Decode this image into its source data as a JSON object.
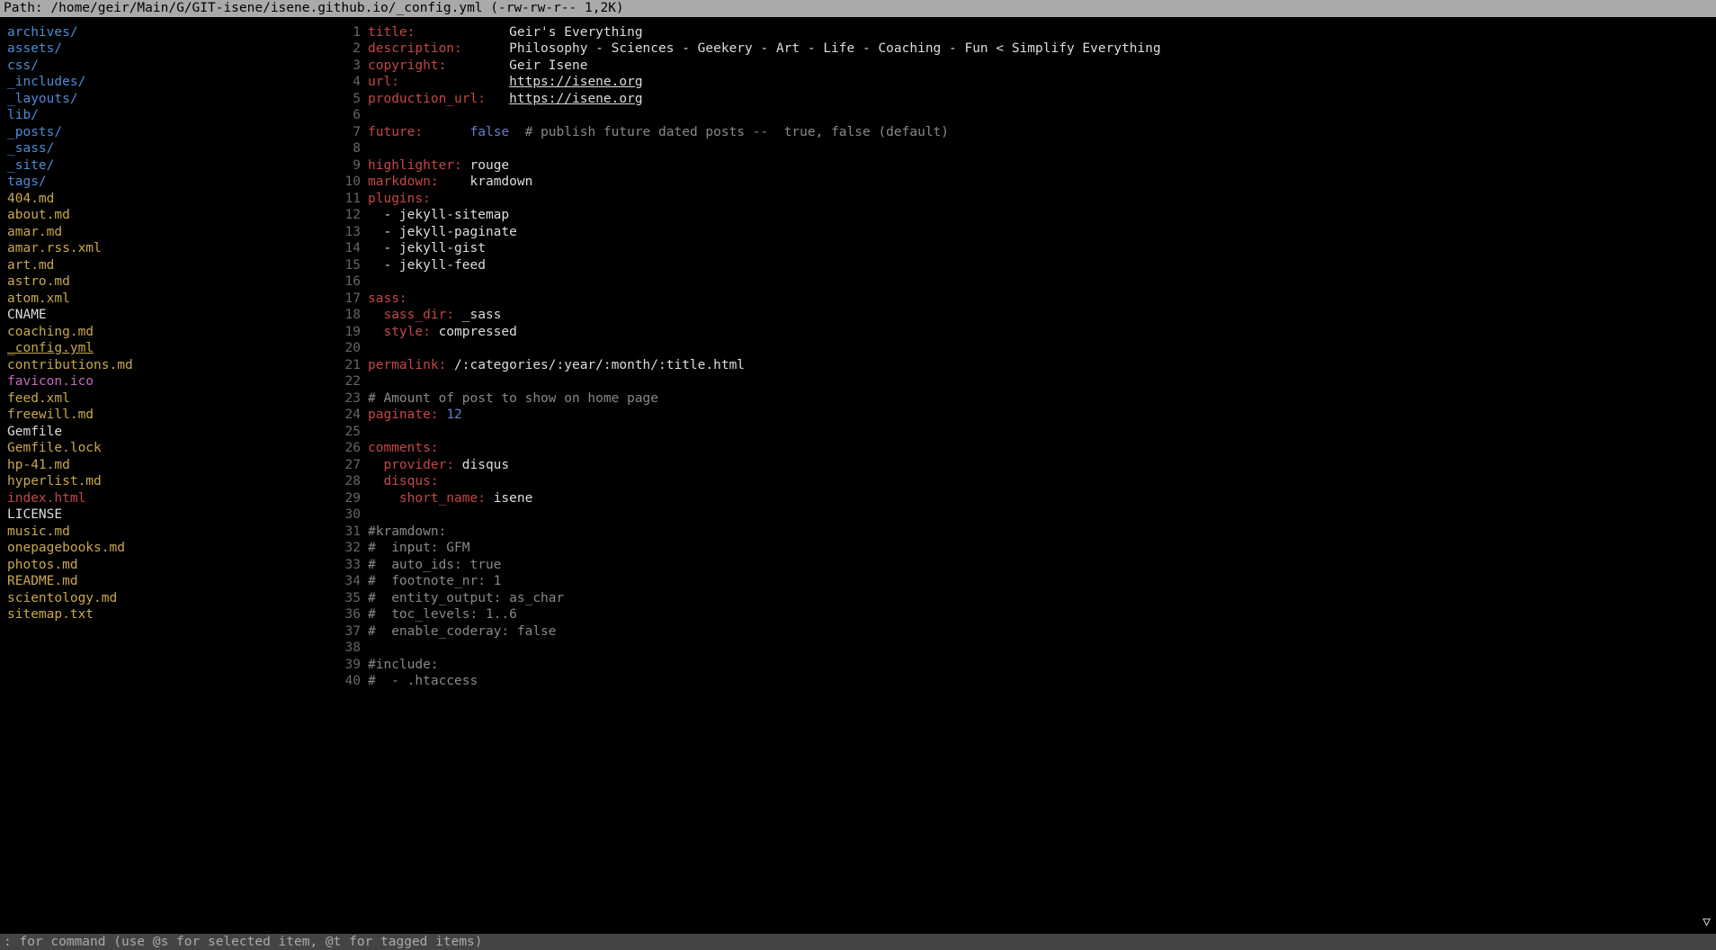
{
  "topbar": {
    "label": "Path: ",
    "path": "/home/geir/Main/G/GIT-isene/isene.github.io/_config.yml",
    "perms": " (-rw-rw-r-- 1,2K)"
  },
  "files": [
    {
      "name": "archives/",
      "cls": "c-dir"
    },
    {
      "name": "assets/",
      "cls": "c-dir"
    },
    {
      "name": "css/",
      "cls": "c-dir"
    },
    {
      "name": "_includes/",
      "cls": "c-dir"
    },
    {
      "name": "_layouts/",
      "cls": "c-dir"
    },
    {
      "name": "lib/",
      "cls": "c-dir"
    },
    {
      "name": "_posts/",
      "cls": "c-dir"
    },
    {
      "name": "_sass/",
      "cls": "c-dir"
    },
    {
      "name": "_site/",
      "cls": "c-dir"
    },
    {
      "name": "tags/",
      "cls": "c-dir"
    },
    {
      "name": "404.md",
      "cls": "c-yellow"
    },
    {
      "name": "about.md",
      "cls": "c-yellow"
    },
    {
      "name": "amar.md",
      "cls": "c-yellow"
    },
    {
      "name": "amar.rss.xml",
      "cls": "c-yellow"
    },
    {
      "name": "art.md",
      "cls": "c-yellow"
    },
    {
      "name": "astro.md",
      "cls": "c-yellow"
    },
    {
      "name": "atom.xml",
      "cls": "c-yellow"
    },
    {
      "name": "CNAME",
      "cls": "c-white"
    },
    {
      "name": "coaching.md",
      "cls": "c-yellow"
    },
    {
      "name": "_config.yml",
      "cls": "c-yellow",
      "selected": true
    },
    {
      "name": "contributions.md",
      "cls": "c-yellow"
    },
    {
      "name": "favicon.ico",
      "cls": "c-magenta"
    },
    {
      "name": "feed.xml",
      "cls": "c-yellow"
    },
    {
      "name": "freewill.md",
      "cls": "c-yellow"
    },
    {
      "name": "Gemfile",
      "cls": "c-white"
    },
    {
      "name": "Gemfile.lock",
      "cls": "c-yellow"
    },
    {
      "name": "hp-41.md",
      "cls": "c-yellow"
    },
    {
      "name": "hyperlist.md",
      "cls": "c-yellow"
    },
    {
      "name": "index.html",
      "cls": "c-red"
    },
    {
      "name": "LICENSE",
      "cls": "c-white"
    },
    {
      "name": "music.md",
      "cls": "c-yellow"
    },
    {
      "name": "onepagebooks.md",
      "cls": "c-yellow"
    },
    {
      "name": "photos.md",
      "cls": "c-yellow"
    },
    {
      "name": "README.md",
      "cls": "c-yellow"
    },
    {
      "name": "scientology.md",
      "cls": "c-yellow"
    },
    {
      "name": "sitemap.txt",
      "cls": "c-yellow"
    }
  ],
  "editor": [
    {
      "n": 1,
      "seg": [
        {
          "t": "title:            ",
          "c": "c-key"
        },
        {
          "t": "Geir's Everything",
          "c": "c-val"
        }
      ]
    },
    {
      "n": 2,
      "seg": [
        {
          "t": "description:      ",
          "c": "c-key"
        },
        {
          "t": "Philosophy - Sciences - Geekery - Art - Life - Coaching - Fun < Simplify Everything",
          "c": "c-val"
        }
      ]
    },
    {
      "n": 3,
      "seg": [
        {
          "t": "copyright:        ",
          "c": "c-key"
        },
        {
          "t": "Geir Isene",
          "c": "c-val"
        }
      ]
    },
    {
      "n": 4,
      "seg": [
        {
          "t": "url:              ",
          "c": "c-key"
        },
        {
          "t": "https://isene.org",
          "c": "c-link"
        }
      ]
    },
    {
      "n": 5,
      "seg": [
        {
          "t": "production_url:   ",
          "c": "c-key"
        },
        {
          "t": "https://isene.org",
          "c": "c-link"
        }
      ]
    },
    {
      "n": 6,
      "seg": []
    },
    {
      "n": 7,
      "seg": [
        {
          "t": "future:      ",
          "c": "c-key"
        },
        {
          "t": "false",
          "c": "c-blue"
        },
        {
          "t": "  # publish future dated posts --  true, false (default)",
          "c": "c-grey"
        }
      ]
    },
    {
      "n": 8,
      "seg": []
    },
    {
      "n": 9,
      "seg": [
        {
          "t": "highlighter: ",
          "c": "c-key"
        },
        {
          "t": "rouge",
          "c": "c-val"
        }
      ]
    },
    {
      "n": 10,
      "seg": [
        {
          "t": "markdown:    ",
          "c": "c-key"
        },
        {
          "t": "kramdown",
          "c": "c-val"
        }
      ]
    },
    {
      "n": 11,
      "seg": [
        {
          "t": "plugins:",
          "c": "c-key"
        }
      ]
    },
    {
      "n": 12,
      "seg": [
        {
          "t": "  - jekyll-sitemap",
          "c": "c-val"
        }
      ]
    },
    {
      "n": 13,
      "seg": [
        {
          "t": "  - jekyll-paginate",
          "c": "c-val"
        }
      ]
    },
    {
      "n": 14,
      "seg": [
        {
          "t": "  - jekyll-gist",
          "c": "c-val"
        }
      ]
    },
    {
      "n": 15,
      "seg": [
        {
          "t": "  - jekyll-feed",
          "c": "c-val"
        }
      ]
    },
    {
      "n": 16,
      "seg": []
    },
    {
      "n": 17,
      "seg": [
        {
          "t": "sass:",
          "c": "c-key"
        }
      ]
    },
    {
      "n": 18,
      "seg": [
        {
          "t": "  sass_dir: ",
          "c": "c-key"
        },
        {
          "t": "_sass",
          "c": "c-val"
        }
      ]
    },
    {
      "n": 19,
      "seg": [
        {
          "t": "  style: ",
          "c": "c-key"
        },
        {
          "t": "compressed",
          "c": "c-val"
        }
      ]
    },
    {
      "n": 20,
      "seg": []
    },
    {
      "n": 21,
      "seg": [
        {
          "t": "permalink: ",
          "c": "c-key"
        },
        {
          "t": "/:categories/:year/:month/:title.html",
          "c": "c-val"
        }
      ]
    },
    {
      "n": 22,
      "seg": []
    },
    {
      "n": 23,
      "seg": [
        {
          "t": "# Amount of post to show on home page",
          "c": "c-grey"
        }
      ]
    },
    {
      "n": 24,
      "seg": [
        {
          "t": "paginate: ",
          "c": "c-key"
        },
        {
          "t": "12",
          "c": "c-blue"
        }
      ]
    },
    {
      "n": 25,
      "seg": []
    },
    {
      "n": 26,
      "seg": [
        {
          "t": "comments:",
          "c": "c-key"
        }
      ]
    },
    {
      "n": 27,
      "seg": [
        {
          "t": "  provider: ",
          "c": "c-key"
        },
        {
          "t": "disqus",
          "c": "c-val"
        }
      ]
    },
    {
      "n": 28,
      "seg": [
        {
          "t": "  disqus:",
          "c": "c-key"
        }
      ]
    },
    {
      "n": 29,
      "seg": [
        {
          "t": "    short_name: ",
          "c": "c-key"
        },
        {
          "t": "isene",
          "c": "c-val"
        }
      ]
    },
    {
      "n": 30,
      "seg": []
    },
    {
      "n": 31,
      "seg": [
        {
          "t": "#kramdown:",
          "c": "c-grey"
        }
      ]
    },
    {
      "n": 32,
      "seg": [
        {
          "t": "#  input: GFM",
          "c": "c-grey"
        }
      ]
    },
    {
      "n": 33,
      "seg": [
        {
          "t": "#  auto_ids: true",
          "c": "c-grey"
        }
      ]
    },
    {
      "n": 34,
      "seg": [
        {
          "t": "#  footnote_nr: 1",
          "c": "c-grey"
        }
      ]
    },
    {
      "n": 35,
      "seg": [
        {
          "t": "#  entity_output: as_char",
          "c": "c-grey"
        }
      ]
    },
    {
      "n": 36,
      "seg": [
        {
          "t": "#  toc_levels: 1..6",
          "c": "c-grey"
        }
      ]
    },
    {
      "n": 37,
      "seg": [
        {
          "t": "#  enable_coderay: false",
          "c": "c-grey"
        }
      ]
    },
    {
      "n": 38,
      "seg": []
    },
    {
      "n": 39,
      "seg": [
        {
          "t": "#include:",
          "c": "c-grey"
        }
      ]
    },
    {
      "n": 40,
      "seg": [
        {
          "t": "#  - .htaccess",
          "c": "c-grey"
        }
      ]
    }
  ],
  "scroll_indicator": "▽",
  "bottombar": {
    "text": ": for command (use @s for selected item, @t for tagged items)"
  }
}
